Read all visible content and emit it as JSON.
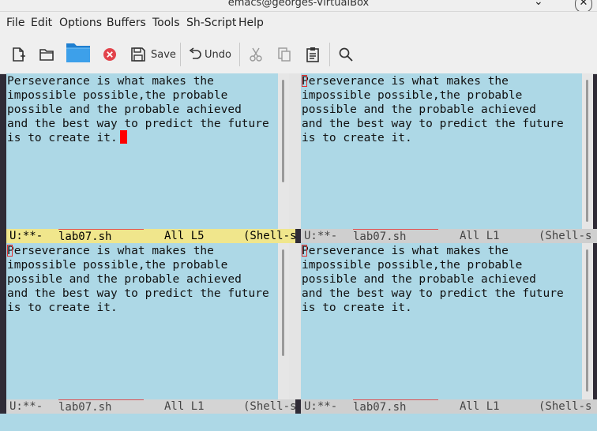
{
  "window": {
    "title": "emacs@georges-VirtualBox"
  },
  "menu": [
    "File",
    "Edit",
    "Options",
    "Buffers",
    "Tools",
    "Sh-Script",
    "Help"
  ],
  "toolbar": {
    "save_label": "Save",
    "undo_label": "Undo"
  },
  "buffer_lines": [
    "Perseverance is what makes the",
    "impossible possible,the probable",
    "possible and the probable achieved",
    "and the best way to predict the future",
    "is to create it."
  ],
  "windows": [
    {
      "id": "top-left",
      "active": true,
      "mode_state": "U:**-",
      "buffer": "lab07.sh",
      "position": "All L5",
      "major_mode": "(Shell-s"
    },
    {
      "id": "top-right",
      "active": false,
      "mode_state": "U:**-",
      "buffer": "lab07.sh",
      "position": "All L1",
      "major_mode": "(Shell-s"
    },
    {
      "id": "bottom-left",
      "active": false,
      "mode_state": "U:**-",
      "buffer": "lab07.sh",
      "position": "All L1",
      "major_mode": "(Shell-s"
    },
    {
      "id": "bottom-right",
      "active": false,
      "mode_state": "U:**-",
      "buffer": "lab07.sh",
      "position": "All L1",
      "major_mode": "(Shell-s"
    }
  ]
}
